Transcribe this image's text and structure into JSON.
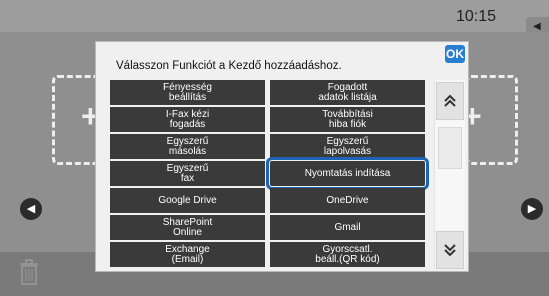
{
  "status": {
    "clock": "10:15"
  },
  "dialog": {
    "title": "Válasszon Funkciót a Kezdő hozzáadáshoz.",
    "ok_label": "OK",
    "functions": [
      {
        "label": "Fényesség\nbeállítás",
        "col": 0,
        "row": 0
      },
      {
        "label": "Fogadott\nadatok listája",
        "col": 1,
        "row": 0
      },
      {
        "label": "I-Fax kézi\nfogadás",
        "col": 0,
        "row": 1
      },
      {
        "label": "Továbbítási\nhiba fiók",
        "col": 1,
        "row": 1
      },
      {
        "label": "Egyszerű\nmásolás",
        "col": 0,
        "row": 2
      },
      {
        "label": "Egyszerű\nlapolvasás",
        "col": 1,
        "row": 2
      },
      {
        "label": "Egyszerű\nfax",
        "col": 0,
        "row": 3
      },
      {
        "label": "Nyomtatás indítása",
        "col": 1,
        "row": 3,
        "selected": true
      },
      {
        "label": "Google Drive",
        "col": 0,
        "row": 4
      },
      {
        "label": "OneDrive",
        "col": 1,
        "row": 4
      },
      {
        "label": "SharePoint\nOnline",
        "col": 0,
        "row": 5
      },
      {
        "label": "Gmail",
        "col": 1,
        "row": 5
      },
      {
        "label": "Exchange\n(Email)",
        "col": 0,
        "row": 6
      },
      {
        "label": "Gyorscsatl.\nbeáll.(QR kód)",
        "col": 1,
        "row": 6
      }
    ]
  },
  "icons": {
    "scroll_up": "chevron-up-double-icon",
    "scroll_down": "chevron-down-double-icon",
    "nav_left": "arrow-left-icon",
    "nav_right": "arrow-right-icon",
    "trash": "trash-icon"
  },
  "colors": {
    "selection": "#1e64b4",
    "ok_button": "#2a7ed0",
    "function_button": "#3a3a3a"
  }
}
